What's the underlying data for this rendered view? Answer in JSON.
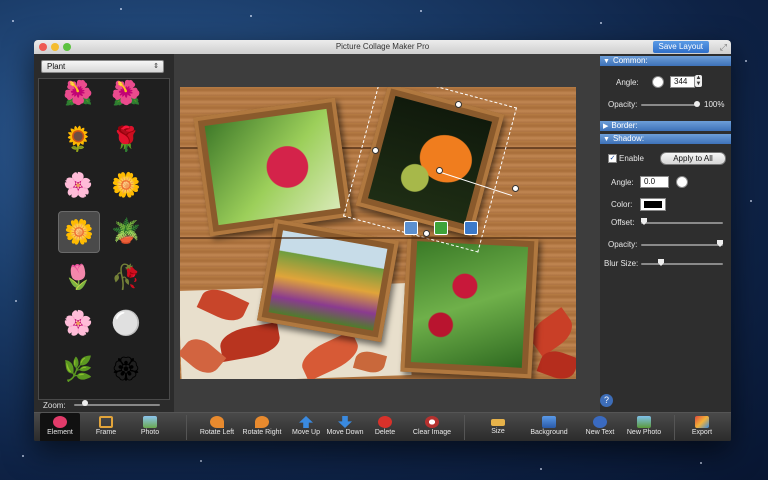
{
  "window": {
    "title": "Picture Collage Maker Pro",
    "save_layout": "Save Layout"
  },
  "left_panel": {
    "category": "Plant",
    "zoom_label": "Zoom:",
    "zoom_level": 0.1,
    "items": [
      {
        "name": "red-flower-icon",
        "glyph": "🌺"
      },
      {
        "name": "orange-flower-icon",
        "glyph": "🌺"
      },
      {
        "name": "sunflower-icon",
        "glyph": "🌻"
      },
      {
        "name": "pink-rose-icon",
        "glyph": "🌹"
      },
      {
        "name": "pink-flower-icon",
        "glyph": "🌸"
      },
      {
        "name": "blue-flower-icon",
        "glyph": "🌼"
      },
      {
        "name": "smiling-flower-icon",
        "glyph": "🌼"
      },
      {
        "name": "potted-flower-icon",
        "glyph": "🪴"
      },
      {
        "name": "tulip-bud-icon",
        "glyph": "🌷"
      },
      {
        "name": "red-bud-icon",
        "glyph": "🥀"
      },
      {
        "name": "pink-blossom-icon",
        "glyph": "🌸"
      },
      {
        "name": "dandelion-icon",
        "glyph": "⚪"
      },
      {
        "name": "grass-tuft-icon",
        "glyph": "🌿"
      },
      {
        "name": "pinwheel-icon",
        "glyph": "🏵"
      }
    ]
  },
  "right_panel": {
    "common": {
      "header": "Common:",
      "angle_label": "Angle:",
      "angle_value": "344",
      "opacity_label": "Opacity:",
      "opacity_value": "100%"
    },
    "border": {
      "header": "Border:"
    },
    "shadow": {
      "header": "Shadow:",
      "enable_label": "Enable",
      "apply_all": "Apply to All",
      "angle_label": "Angle:",
      "angle_value": "0.0",
      "color_label": "Color:",
      "color_value": "#000000",
      "offset_label": "Offset:",
      "opacity_label": "Opacity:",
      "blur_label": "Blur Size:"
    }
  },
  "toolbar": {
    "element": "Element",
    "frame": "Frame",
    "photo": "Photo",
    "rotate_left": "Rotate Left",
    "rotate_right": "Rotate Right",
    "move_up": "Move Up",
    "move_down": "Move Down",
    "delete": "Delete",
    "clear_image": "Clear Image",
    "size": "Size",
    "background": "Background",
    "new_text": "New Text",
    "new_photo": "New Photo",
    "export": "Export"
  },
  "help": "?",
  "colors": {
    "accent": "#3e72b8",
    "wood": "#b57b44"
  }
}
